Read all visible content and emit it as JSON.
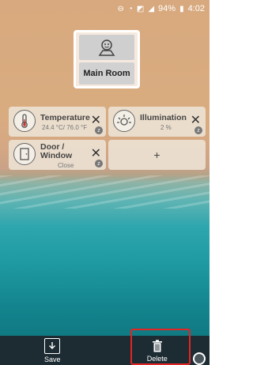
{
  "status": {
    "battery": "94%",
    "time": "4:02"
  },
  "room": {
    "name": "Main Room"
  },
  "tiles": [
    {
      "title": "Temperature",
      "value": "24.4 °C/ 76.0 °F"
    },
    {
      "title": "Illumination",
      "value": "2 %"
    },
    {
      "title_line1": "Door /",
      "title_line2": "Window",
      "value": "Close"
    }
  ],
  "add_tile_label": "+",
  "bottom": {
    "save_label": "Save",
    "delete_label": "Delete"
  },
  "icons": {
    "status": [
      "do-not-disturb-icon",
      "wifi-icon",
      "signal-icon",
      "battery-icon"
    ],
    "room": "room-avatar-icon",
    "temperature": "thermometer-icon",
    "illumination": "sun-icon",
    "door": "door-icon",
    "save": "save-download-icon",
    "delete": "trash-icon"
  }
}
